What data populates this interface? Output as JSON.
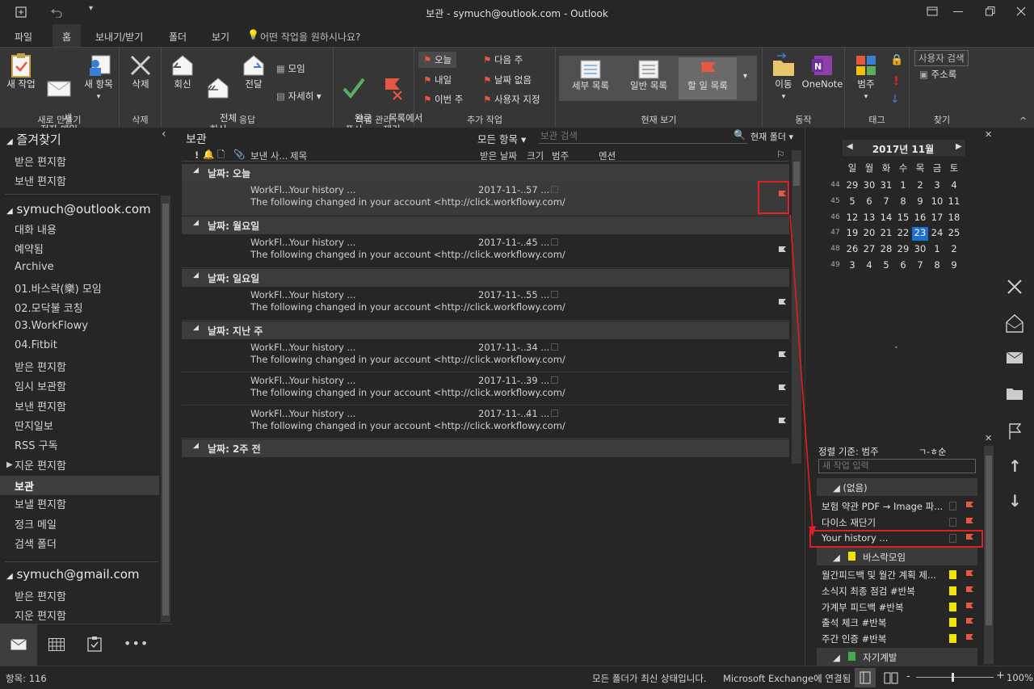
{
  "window": {
    "title": "보관 - symuch@outlook.com  -  Outlook"
  },
  "tabs": [
    "파일",
    "홈",
    "보내기/받기",
    "폴더",
    "보기"
  ],
  "tell_me": "어떤 작업을 원하시나요?",
  "ribbon": {
    "new": {
      "new_task": "새 작업",
      "new_email": "새\n전자 메일",
      "new_items": "새 항목",
      "label": "새로 만들기"
    },
    "delete": {
      "delete": "삭제",
      "label": "삭제"
    },
    "respond": {
      "reply": "회신",
      "reply_all": "전체\n회신",
      "forward": "전달",
      "meeting": "모임",
      "more": "자세히",
      "label": "응답"
    },
    "manage": {
      "mark_complete": "완료\n표시",
      "remove": "목록에서\n제거",
      "label": "작업 관리"
    },
    "followup": {
      "today": "오늘",
      "tomorrow": "내일",
      "this_week": "이번 주",
      "next_week": "다음 주",
      "no_date": "날짜 없음",
      "custom": "사용자 지정",
      "label": "추가 작업"
    },
    "view": {
      "detailed": "세부 목록",
      "simple": "일반 목록",
      "todo": "할 일 목록",
      "label": "현재 보기"
    },
    "actions": {
      "move": "이동",
      "onenote": "OneNote",
      "label": "동작"
    },
    "tags": {
      "categorize": "범주",
      "label": "태그"
    },
    "find": {
      "search_people": "사용자 검색",
      "address_book": "주소록",
      "label": "찾기"
    }
  },
  "nav": {
    "favorites": "즐겨찾기",
    "fav_items": [
      "받은 편지함",
      "보낸 편지함"
    ],
    "account1": "symuch@outlook.com",
    "acct1_items": [
      "대화 내용",
      "예약됨",
      "Archive",
      "01.바스락(樂) 모임",
      "02.모닥불 코칭",
      "03.WorkFlowy",
      "04.Fitbit",
      "받은 편지함",
      "임시 보관함",
      "보낸 편지함",
      "딴지일보",
      "RSS 구독",
      "지운 편지함",
      "보관",
      "보낼 편지함",
      "정크 메일",
      "검색 폴더"
    ],
    "account2": "symuch@gmail.com",
    "acct2_items": [
      "받은 편지함",
      "지운 편지함"
    ]
  },
  "list": {
    "folder": "보관",
    "filter": "모든 항목",
    "search_placeholder": "보관 검색",
    "scope": "현재 폴더",
    "headers": {
      "from": "보낸 사...",
      "subject": "제목",
      "received": "받은 날짜",
      "size": "크기",
      "category": "범주",
      "mention": "멘션"
    },
    "groups": [
      {
        "label": "날짜: 오늘",
        "rows": [
          {
            "from": "WorkFl...",
            "subject": "Your history ...",
            "date": "2017-11-...",
            "size": "57 ...",
            "preview": "The following changed in your account <http://click.workflowy.com/"
          }
        ]
      },
      {
        "label": "날짜: 월요일",
        "rows": [
          {
            "from": "WorkFl...",
            "subject": "Your history ...",
            "date": "2017-11-...",
            "size": "45 ...",
            "preview": "The following changed in your account <http://click.workflowy.com/"
          }
        ]
      },
      {
        "label": "날짜: 일요일",
        "rows": [
          {
            "from": "WorkFl...",
            "subject": "Your history ...",
            "date": "2017-11-...",
            "size": "55 ...",
            "preview": "The following changed in your account <http://click.workflowy.com/"
          }
        ]
      },
      {
        "label": "날짜: 지난 주",
        "rows": [
          {
            "from": "WorkFl...",
            "subject": "Your history ...",
            "date": "2017-11-...",
            "size": "34 ...",
            "preview": "The following changed in your account <http://click.workflowy.com/"
          },
          {
            "from": "WorkFl...",
            "subject": "Your history ...",
            "date": "2017-11-...",
            "size": "39 ...",
            "preview": "The following changed in your account <http://click.workflowy.com/"
          },
          {
            "from": "WorkFl...",
            "subject": "Your history ...",
            "date": "2017-11-...",
            "size": "41 ...",
            "preview": "The following changed in your account <http://click.workflowy.com/"
          }
        ]
      },
      {
        "label": "날짜: 2주 전",
        "rows": []
      }
    ]
  },
  "calendar": {
    "month": "2017년 11월",
    "dow": [
      "일",
      "월",
      "화",
      "수",
      "목",
      "금",
      "토"
    ],
    "weeks": [
      {
        "wk": "44",
        "days": [
          "29",
          "30",
          "31",
          "1",
          "2",
          "3",
          "4"
        ]
      },
      {
        "wk": "45",
        "days": [
          "5",
          "6",
          "7",
          "8",
          "9",
          "10",
          "11"
        ]
      },
      {
        "wk": "46",
        "days": [
          "12",
          "13",
          "14",
          "15",
          "16",
          "17",
          "18"
        ]
      },
      {
        "wk": "47",
        "days": [
          "19",
          "20",
          "21",
          "22",
          "23",
          "24",
          "25"
        ]
      },
      {
        "wk": "48",
        "days": [
          "26",
          "27",
          "28",
          "29",
          "30",
          "1",
          "2"
        ]
      },
      {
        "wk": "49",
        "days": [
          "3",
          "4",
          "5",
          "6",
          "7",
          "8",
          "9"
        ]
      }
    ],
    "today": "23"
  },
  "todo": {
    "sort": "정렬 기준: 범주",
    "order": "ㄱ-ㅎ순",
    "new_placeholder": "새 작업 입력",
    "group_none": "(없음)",
    "items_none": [
      "보험 약관 PDF → Image 파...",
      "다이소 재단기",
      "Your history ..."
    ],
    "group_basrak": "바스락모임",
    "items_basrak": [
      "월간피드백 및 월간 계획 제...",
      "소식지 최종 점검 #반복",
      "가계부 피드백 #반복",
      "출석 체크 #반복",
      "주간 인증 #반복"
    ],
    "group_self": "자기계발"
  },
  "status": {
    "items": "항목: 116",
    "sync": "모든 폴더가 최신 상태입니다.",
    "conn": "Microsoft Exchange에 연결됨",
    "zoom": "100%"
  },
  "colors": {
    "flag": "#e8573f",
    "highlight": "#e02020",
    "today": "#1e6fd0",
    "yellow": "#f2e600",
    "green": "#3fae49"
  }
}
